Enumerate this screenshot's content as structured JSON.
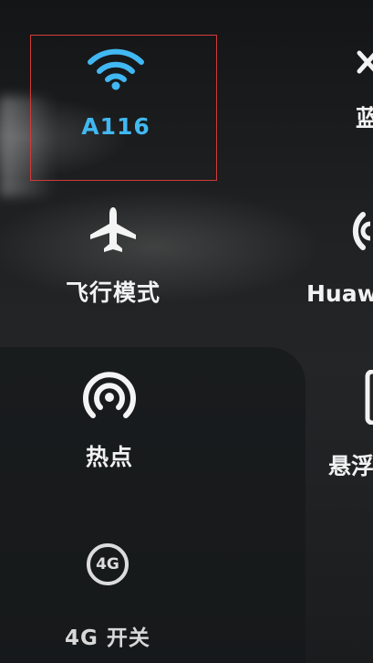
{
  "tiles": [
    {
      "id": "wifi",
      "label": "A116",
      "icon": "wifi-icon",
      "active": true
    },
    {
      "id": "airplane",
      "label": "飞行模式",
      "icon": "airplane-icon",
      "active": false
    },
    {
      "id": "hotspot",
      "label": "热点",
      "icon": "hotspot-icon",
      "active": false
    },
    {
      "id": "mobile-data",
      "label": "4G 开关",
      "icon": "4g-icon",
      "icon_text": "4G",
      "active": false
    }
  ],
  "edge_tiles": [
    {
      "id": "bluetooth",
      "label": "蓝",
      "icon": "bluetooth-icon"
    },
    {
      "id": "huawei-share",
      "label": "Huawe",
      "icon": "share-icon"
    },
    {
      "id": "floating",
      "label": "悬浮",
      "icon": "floating-window-icon"
    }
  ],
  "colors": {
    "active": "#41b8f2",
    "inactive": "#f2f2f2",
    "highlight_box": "#d23a3a"
  }
}
